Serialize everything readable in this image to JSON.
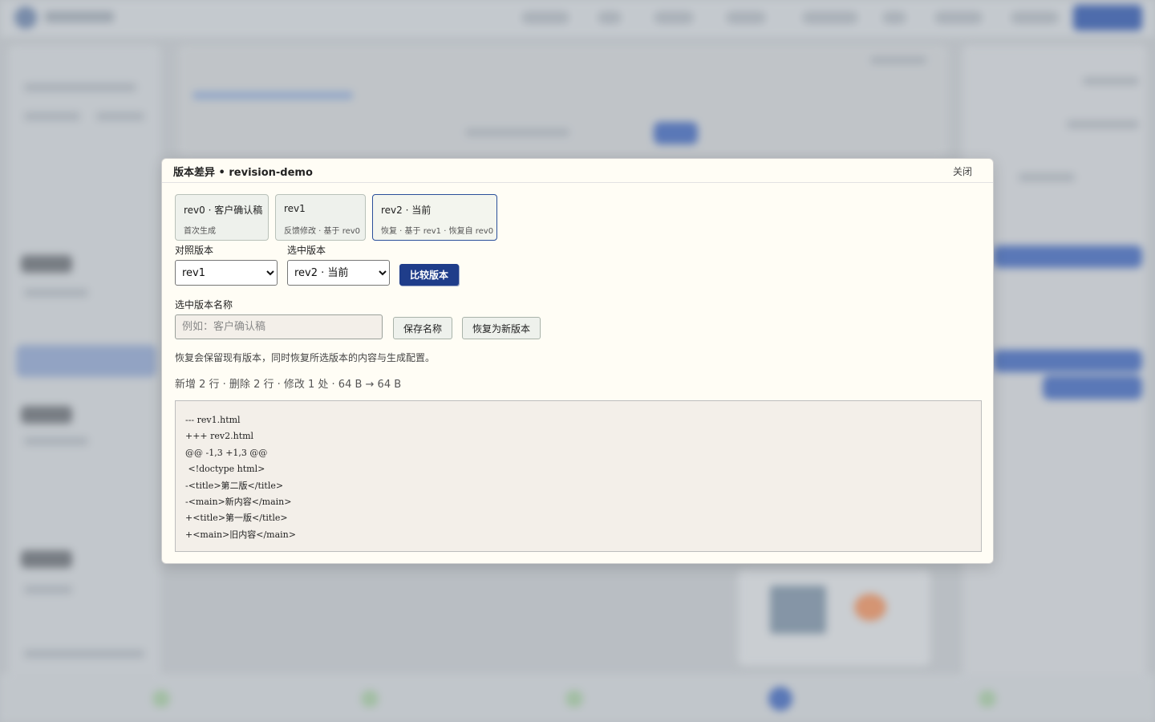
{
  "dialog": {
    "title": "版本差异 • revision-demo",
    "close_label": "关闭"
  },
  "revisions": [
    {
      "name": "rev0 · 客户确认稿",
      "desc": "首次生成",
      "selected": false
    },
    {
      "name": "rev1",
      "desc": "反馈修改 · 基于 rev0",
      "selected": false
    },
    {
      "name": "rev2 · 当前",
      "desc": "恢复 · 基于 rev1 · 恢复自 rev0",
      "selected": true
    }
  ],
  "compare": {
    "base_label": "对照版本",
    "base_value": "rev1",
    "target_label": "选中版本",
    "target_value": "rev2 · 当前",
    "compare_button": "比较版本"
  },
  "rename": {
    "label": "选中版本名称",
    "placeholder": "例如：客户确认稿",
    "value": "",
    "save_button": "保存名称",
    "restore_button": "恢复为新版本"
  },
  "hint": "恢复会保留现有版本，同时恢复所选版本的内容与生成配置。",
  "stats": "新增 2 行 · 删除 2 行 · 修改 1 处 · 64 B → 64 B",
  "diff_lines": [
    "--- rev1.html",
    "+++ rev2.html",
    "@@ -1,3 +1,3 @@",
    " <!doctype html>",
    "-<title>第二版</title>",
    "-<main>新内容</main>",
    "+<title>第一版</title>",
    "+<main>旧内容</main>"
  ]
}
